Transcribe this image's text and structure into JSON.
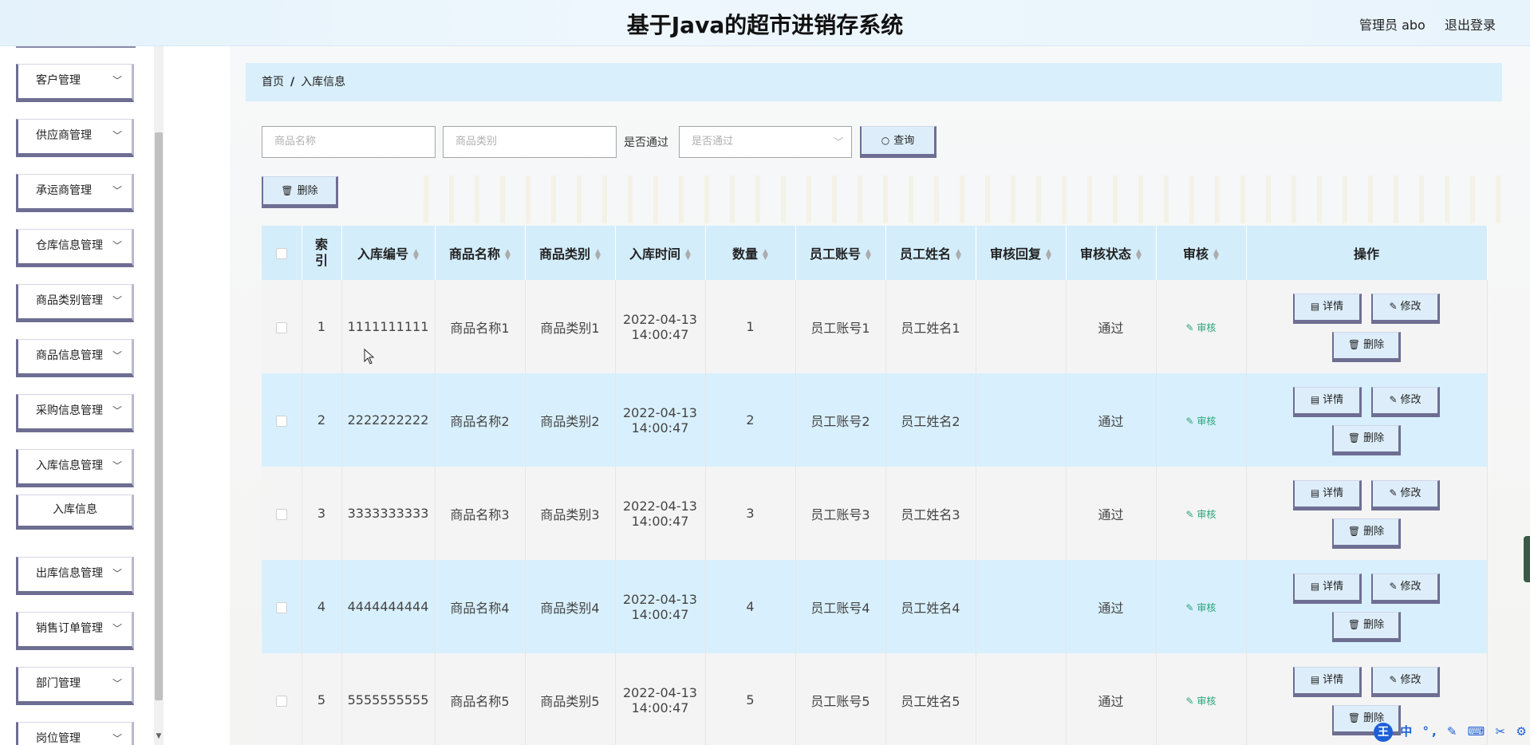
{
  "header": {
    "title": "基于Java的超市进销存系统",
    "admin_label": "管理员 abo",
    "logout_label": "退出登录"
  },
  "sidebar": {
    "items": [
      {
        "label": "客户管理"
      },
      {
        "label": "供应商管理"
      },
      {
        "label": "承运商管理"
      },
      {
        "label": "仓库信息管理"
      },
      {
        "label": "商品类别管理"
      },
      {
        "label": "商品信息管理"
      },
      {
        "label": "采购信息管理"
      },
      {
        "label": "入库信息管理"
      },
      {
        "label": "出库信息管理"
      },
      {
        "label": "销售订单管理"
      },
      {
        "label": "部门管理"
      },
      {
        "label": "岗位管理"
      }
    ],
    "subitem": {
      "label": "入库信息"
    }
  },
  "breadcrumb": {
    "home": "首页",
    "separator": "/",
    "current": "入库信息"
  },
  "search": {
    "name_placeholder": "商品名称",
    "category_placeholder": "商品类别",
    "passed_label": "是否通过",
    "passed_placeholder": "是否通过",
    "search_button": "查询"
  },
  "actions": {
    "bulk_delete": "删除"
  },
  "table": {
    "headers": {
      "index": "索引",
      "code": "入库编号",
      "name": "商品名称",
      "category": "商品类别",
      "time": "入库时间",
      "qty": "数量",
      "emp_account": "员工账号",
      "emp_name": "员工姓名",
      "reply": "审核回复",
      "status": "审核状态",
      "audit": "审核",
      "ops": "操作"
    },
    "rows": [
      {
        "index": "1",
        "code": "1111111111",
        "name": "商品名称1",
        "category": "商品类别1",
        "date": "2022-04-13",
        "time": "14:00:47",
        "qty": "1",
        "emp_account": "员工账号1",
        "emp_name": "员工姓名1",
        "reply": "",
        "status": "通过",
        "audit": "审核"
      },
      {
        "index": "2",
        "code": "2222222222",
        "name": "商品名称2",
        "category": "商品类别2",
        "date": "2022-04-13",
        "time": "14:00:47",
        "qty": "2",
        "emp_account": "员工账号2",
        "emp_name": "员工姓名2",
        "reply": "",
        "status": "通过",
        "audit": "审核"
      },
      {
        "index": "3",
        "code": "3333333333",
        "name": "商品名称3",
        "category": "商品类别3",
        "date": "2022-04-13",
        "time": "14:00:47",
        "qty": "3",
        "emp_account": "员工账号3",
        "emp_name": "员工姓名3",
        "reply": "",
        "status": "通过",
        "audit": "审核"
      },
      {
        "index": "4",
        "code": "4444444444",
        "name": "商品名称4",
        "category": "商品类别4",
        "date": "2022-04-13",
        "time": "14:00:47",
        "qty": "4",
        "emp_account": "员工账号4",
        "emp_name": "员工姓名4",
        "reply": "",
        "status": "通过",
        "audit": "审核"
      },
      {
        "index": "5",
        "code": "5555555555",
        "name": "商品名称5",
        "category": "商品类别5",
        "date": "2022-04-13",
        "time": "14:00:47",
        "qty": "5",
        "emp_account": "员工账号5",
        "emp_name": "员工姓名5",
        "reply": "",
        "status": "通过",
        "audit": "审核"
      }
    ],
    "op_labels": {
      "detail": "详情",
      "edit": "修改",
      "delete": "删除"
    }
  },
  "ime": {
    "logo": "王",
    "chars": "中 °, ✎ ⌨ ✂ ⚙"
  },
  "colors": {
    "header_bg": "#e4f2fb",
    "table_header_bg": "#d4edfb",
    "row_alt_bg": "#d8f0fd",
    "button_border": "#6e6e93",
    "audit_link": "#2aa37a"
  }
}
